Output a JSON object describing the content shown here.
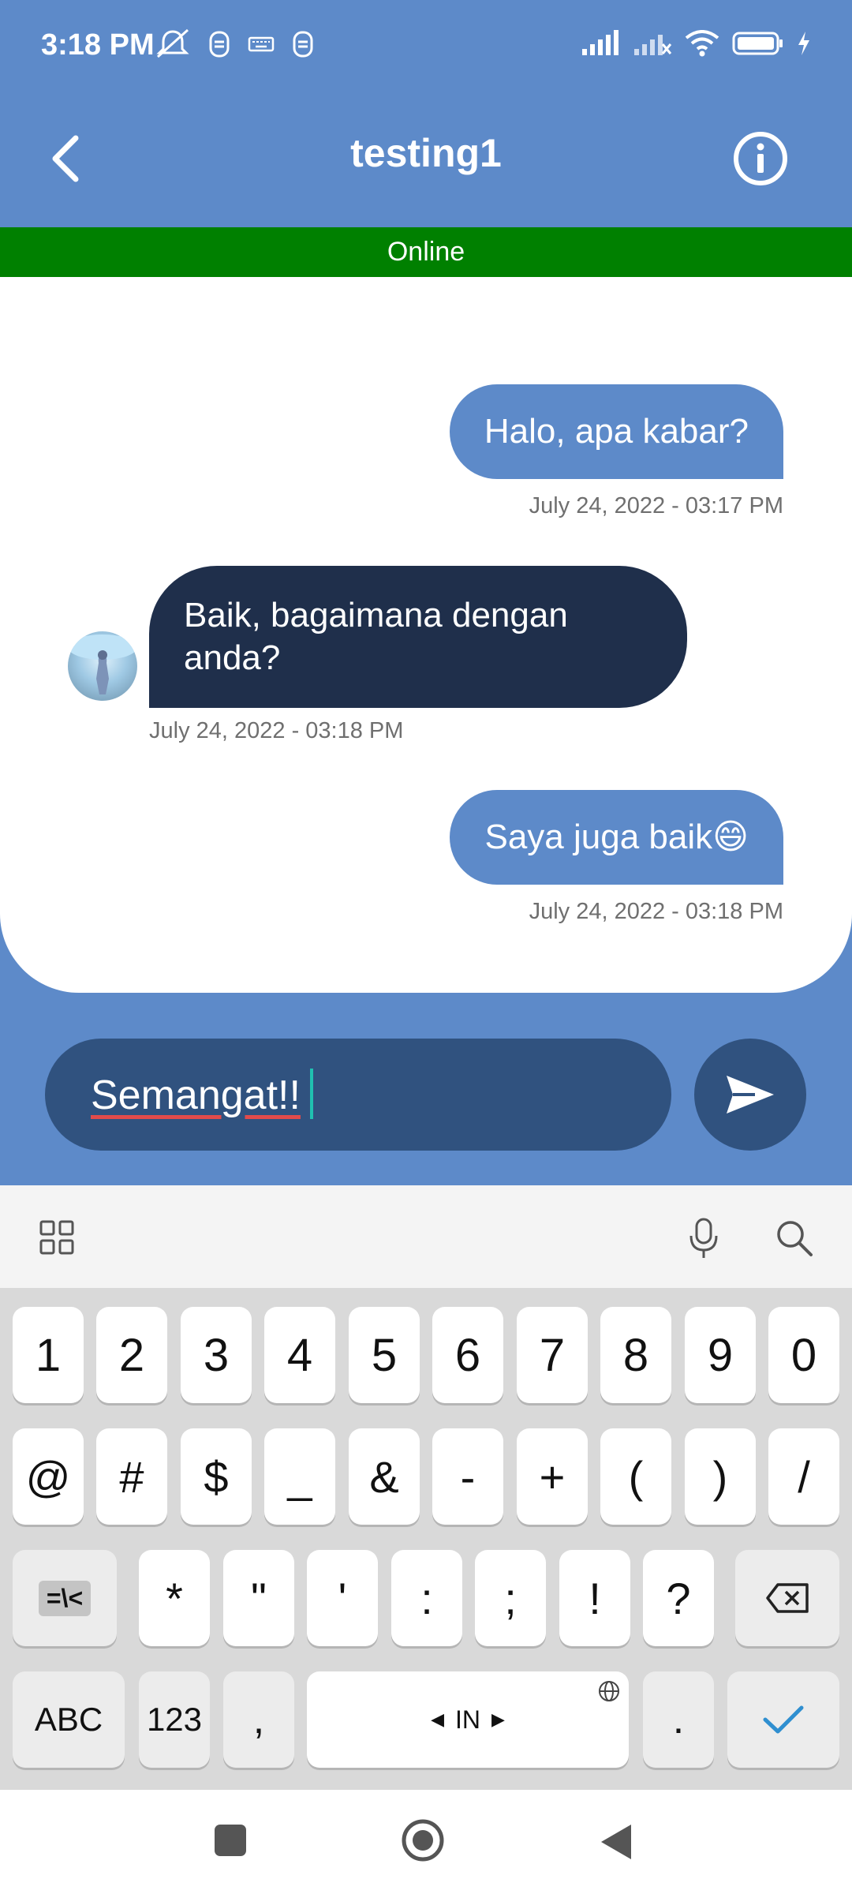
{
  "status_bar": {
    "time": "3:18 PM",
    "left_icons": [
      "mute-icon",
      "notification-icon",
      "keyboard-icon",
      "notification-icon"
    ],
    "right_icons": [
      "signal-icon",
      "signal-off-icon",
      "wifi-icon",
      "battery-icon",
      "charging-icon"
    ]
  },
  "header": {
    "title": "testing1",
    "back_icon": "chevron-left-icon",
    "info_icon": "info-icon"
  },
  "presence": {
    "label": "Online",
    "color": "#008000"
  },
  "messages": [
    {
      "direction": "outgoing",
      "text": "Halo, apa kabar?",
      "timestamp": "July 24, 2022 - 03:17 PM"
    },
    {
      "direction": "incoming",
      "text": "Baik, bagaimana dengan anda?",
      "timestamp": "July 24, 2022 - 03:18 PM"
    },
    {
      "direction": "outgoing",
      "text": "Saya juga baik😄",
      "timestamp": "July 24, 2022 - 03:18 PM"
    }
  ],
  "composer": {
    "value": "Semangat!!",
    "send_icon": "send-icon"
  },
  "keyboard": {
    "toolbar_icons": [
      "grid-icon",
      "microphone-icon",
      "search-icon"
    ],
    "row1": [
      "1",
      "2",
      "3",
      "4",
      "5",
      "6",
      "7",
      "8",
      "9",
      "0"
    ],
    "row2": [
      "@",
      "#",
      "$",
      "_",
      "&",
      "-",
      "+",
      "(",
      ")",
      "/"
    ],
    "row3_left": "=\\<",
    "row3": [
      "*",
      "\"",
      "'",
      ":",
      ";",
      "!",
      "?"
    ],
    "row4": {
      "abc": "ABC",
      "num": "123",
      "comma": ",",
      "space": "IN",
      "period": "."
    }
  },
  "colors": {
    "primary": "#5d8ac9",
    "incoming_bubble": "#1f2f4b",
    "composer": "#30527f"
  }
}
